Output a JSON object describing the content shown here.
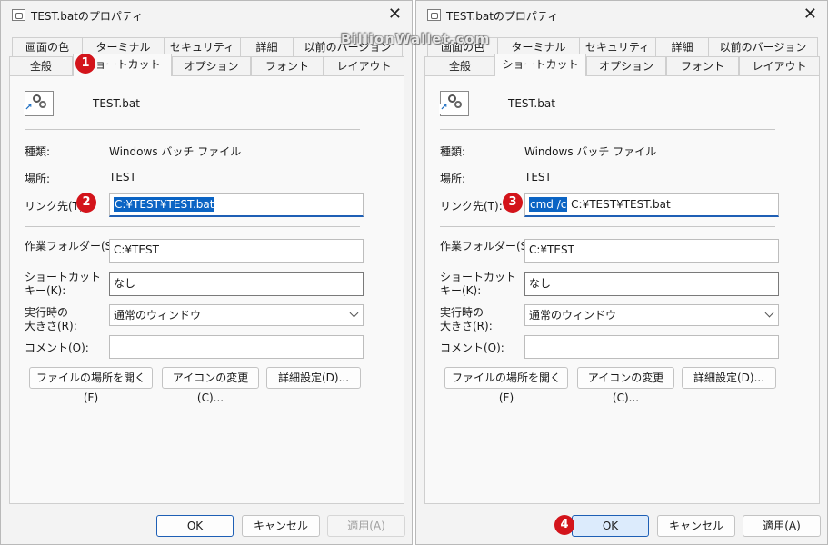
{
  "watermark": "BillionWallet.com",
  "tabs_row1": [
    "画面の色",
    "ターミナル",
    "セキュリティ",
    "詳細",
    "以前のバージョン"
  ],
  "tabs_row2": [
    "全般",
    "ショートカット",
    "オプション",
    "フォント",
    "レイアウト"
  ],
  "active_tab": "ショートカット",
  "badges": [
    "1",
    "2",
    "3",
    "4"
  ],
  "colors": {
    "accent": "#0b64c4",
    "badge": "#d3141b",
    "ok_hover": "#dcebfc"
  },
  "icons": [
    "batch-file-icon",
    "close-icon",
    "chevron-down-icon"
  ],
  "left": {
    "title": "TEST.batのプロパティ",
    "file_name": "TEST.bat",
    "type_label": "種類:",
    "type_value": "Windows バッチ ファイル",
    "location_label": "場所:",
    "location_value": "TEST",
    "link_label": "リンク先(T):",
    "link_value": "C:¥TEST¥TEST.bat",
    "workdir_label": "作業フォルダー(S):",
    "workdir_value": "C:¥TEST",
    "shortcut_label_1": "ショートカット",
    "shortcut_label_2": "キー(K):",
    "shortcut_value": "なし",
    "run_label_1": "実行時の",
    "run_label_2": "大きさ(R):",
    "run_value": "通常のウィンドウ",
    "comment_label": "コメント(O):",
    "comment_value": "",
    "btn_open_location": "ファイルの場所を開く(F)",
    "btn_change_icon": "アイコンの変更(C)...",
    "btn_advanced": "詳細設定(D)...",
    "btn_ok": "OK",
    "btn_cancel": "キャンセル",
    "btn_apply": "適用(A)"
  },
  "right": {
    "title": "TEST.batのプロパティ",
    "file_name": "TEST.bat",
    "type_label": "種類:",
    "type_value": "Windows バッチ ファイル",
    "location_label": "場所:",
    "location_value": "TEST",
    "link_label": "リンク先(T):",
    "link_value_selected": "cmd /c",
    "link_value_rest": " C:¥TEST¥TEST.bat",
    "workdir_label": "作業フォルダー(S):",
    "workdir_value": "C:¥TEST",
    "shortcut_label_1": "ショートカット",
    "shortcut_label_2": "キー(K):",
    "shortcut_value": "なし",
    "run_label_1": "実行時の",
    "run_label_2": "大きさ(R):",
    "run_value": "通常のウィンドウ",
    "comment_label": "コメント(O):",
    "comment_value": "",
    "btn_open_location": "ファイルの場所を開く(F)",
    "btn_change_icon": "アイコンの変更(C)...",
    "btn_advanced": "詳細設定(D)...",
    "btn_ok": "OK",
    "btn_cancel": "キャンセル",
    "btn_apply": "適用(A)"
  }
}
